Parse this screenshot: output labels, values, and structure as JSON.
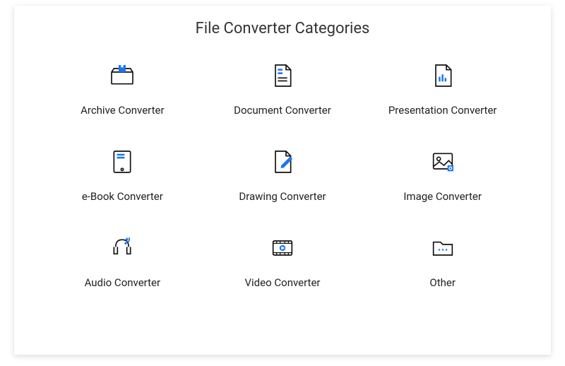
{
  "title": "File Converter Categories",
  "categories": [
    {
      "id": "archive",
      "label": "Archive Converter"
    },
    {
      "id": "document",
      "label": "Document Converter"
    },
    {
      "id": "presentation",
      "label": "Presentation Converter"
    },
    {
      "id": "ebook",
      "label": "e-Book Converter"
    },
    {
      "id": "drawing",
      "label": "Drawing Converter"
    },
    {
      "id": "image",
      "label": "Image Converter"
    },
    {
      "id": "audio",
      "label": "Audio Converter"
    },
    {
      "id": "video",
      "label": "Video Converter"
    },
    {
      "id": "other",
      "label": "Other"
    }
  ],
  "colors": {
    "accent": "#1976f2",
    "stroke": "#111"
  }
}
